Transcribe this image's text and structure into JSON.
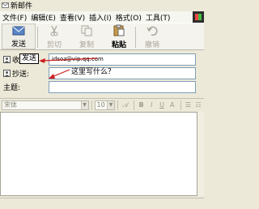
{
  "window": {
    "title": "新邮件"
  },
  "menu": [
    "文件(F)",
    "编辑(E)",
    "查看(V)",
    "插入(I)",
    "格式(O)",
    "工具(T)"
  ],
  "toolbar": {
    "send": "发送",
    "cut": "剪切",
    "copy": "复制",
    "paste": "粘贴",
    "undo": "撤销"
  },
  "headers": {
    "to_label": "收件人:",
    "to_value": "idsoz@vip.qq.com",
    "cc_label": "抄送:",
    "cc_value": "",
    "subject_label": "主题:",
    "subject_value": ""
  },
  "annotations": {
    "callout": "发送",
    "note": "这里写什么？"
  },
  "format": {
    "font": "宋体",
    "size": "10",
    "bold": "B",
    "italic": "I",
    "underline": "U",
    "color": "A"
  },
  "colors": {
    "annotation_arrow": "#cc1f1f",
    "field_border": "#7f9db9"
  }
}
